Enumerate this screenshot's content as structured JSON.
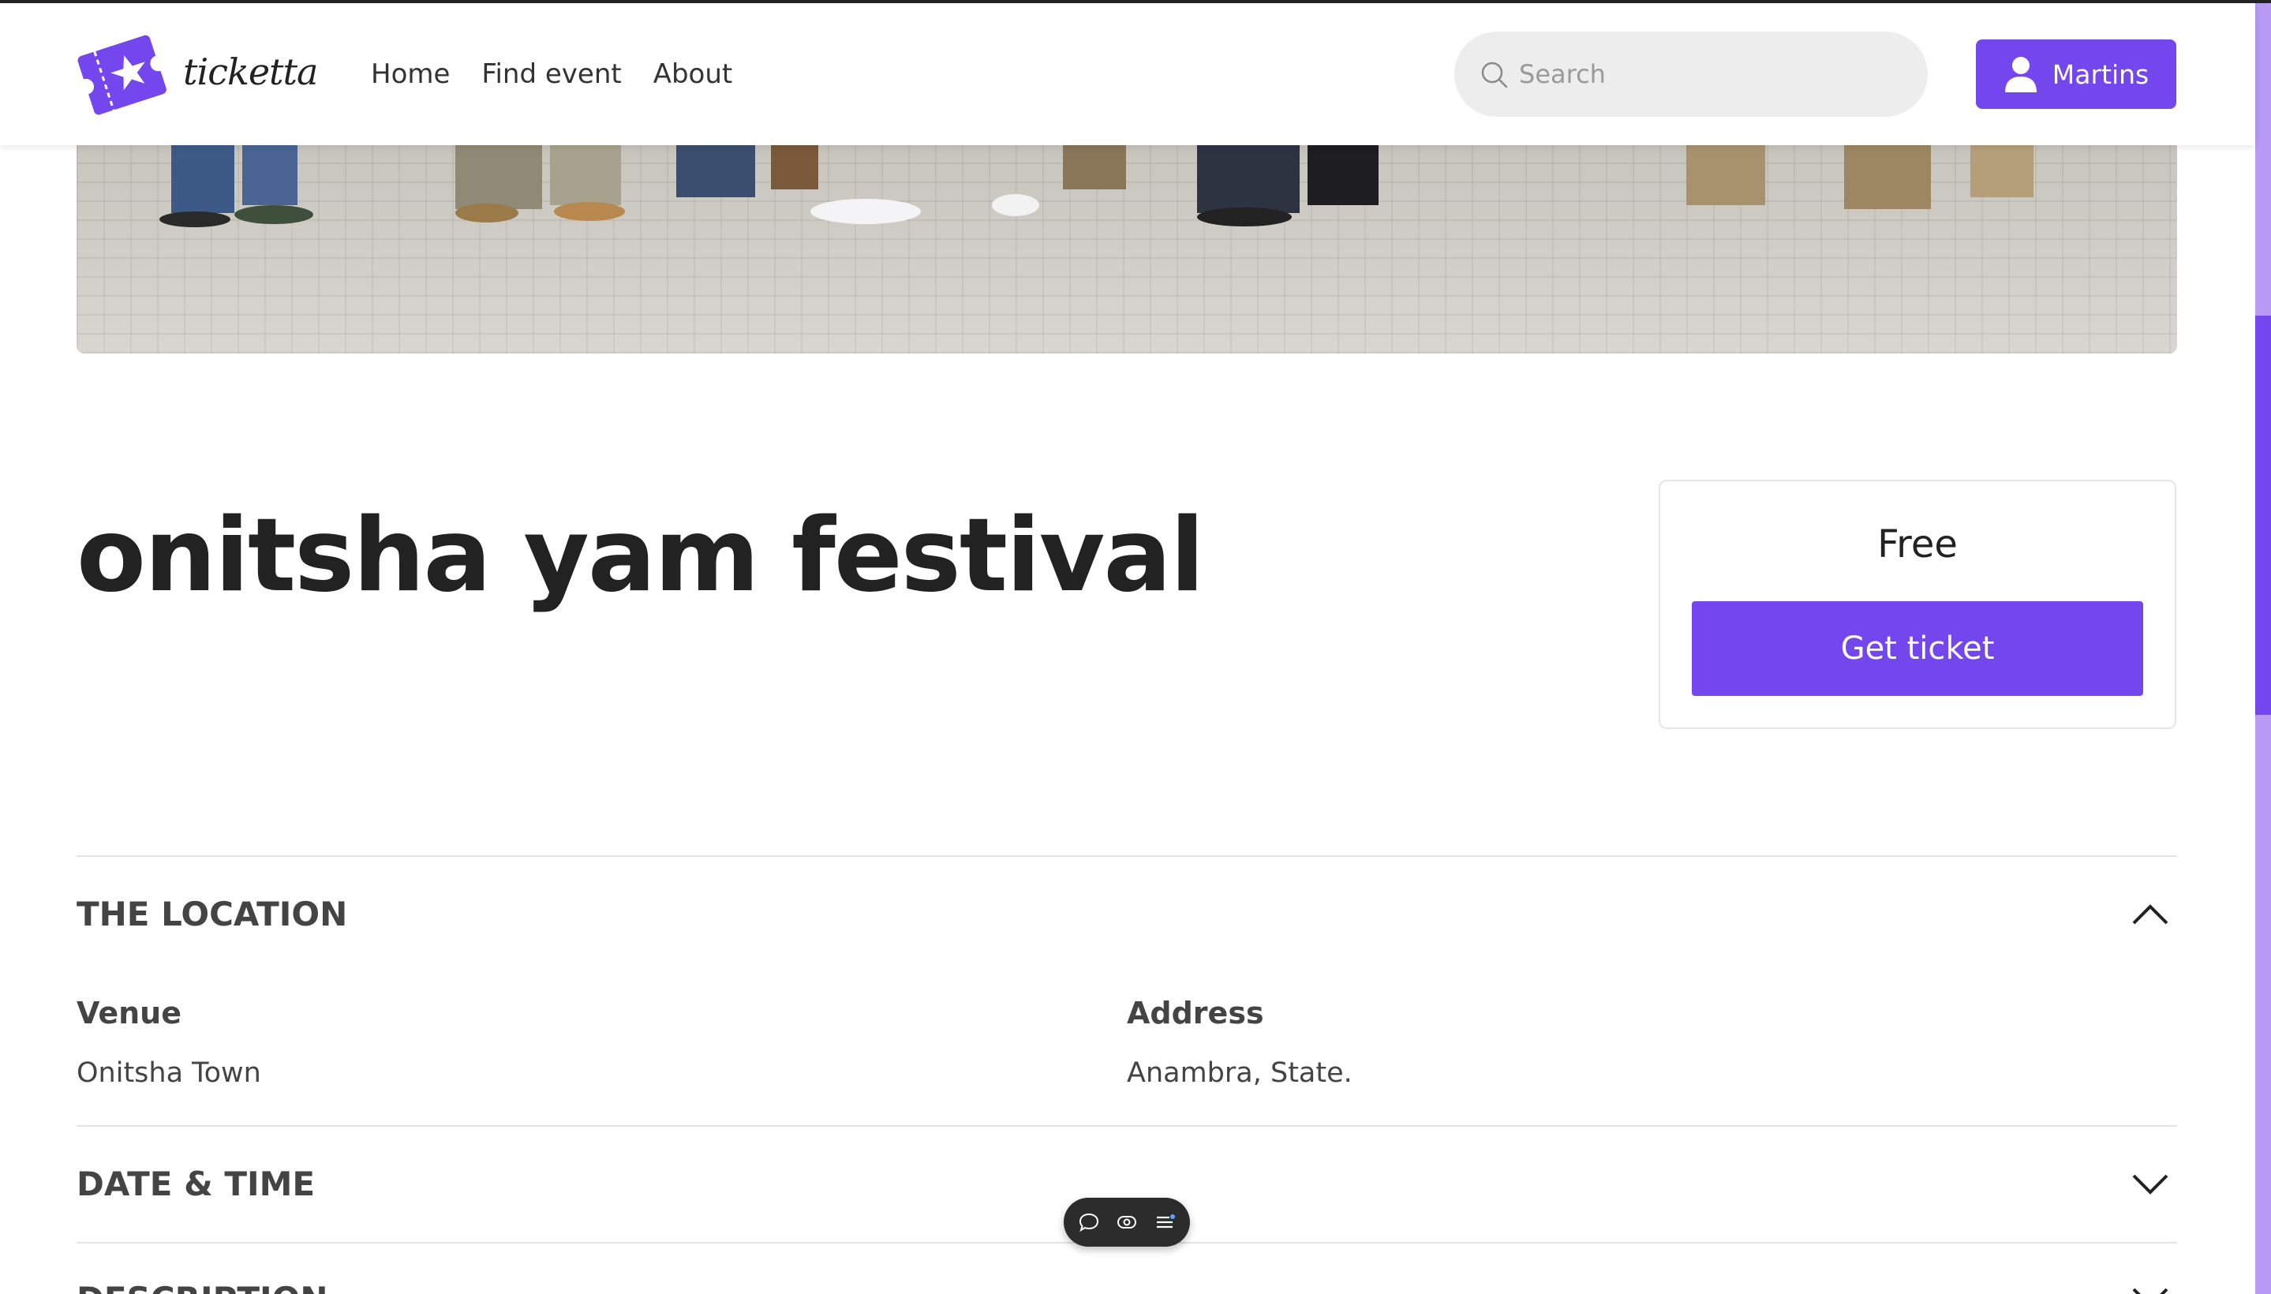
{
  "brand": {
    "name": "ticketta",
    "accent": "#7446ee"
  },
  "nav": {
    "items": [
      "Home",
      "Find event",
      "About"
    ]
  },
  "search": {
    "placeholder": "Search"
  },
  "user": {
    "name": "Martins"
  },
  "event": {
    "title": "onitsha yam festival",
    "price": "Free",
    "cta": "Get ticket"
  },
  "sections": {
    "location": {
      "title": "THE LOCATION",
      "expanded": true,
      "venue_label": "Venue",
      "venue_value": "Onitsha Town",
      "address_label": "Address",
      "address_value": "Anambra, State."
    },
    "datetime": {
      "title": "DATE & TIME",
      "expanded": false
    },
    "description": {
      "title": "DESCRIPTION",
      "expanded": false
    }
  },
  "icons": {
    "logo": "ticket-star-logo",
    "search": "search-icon",
    "user": "user-icon",
    "toolbar": [
      "chat-icon",
      "eye-icon",
      "list-icon"
    ]
  }
}
